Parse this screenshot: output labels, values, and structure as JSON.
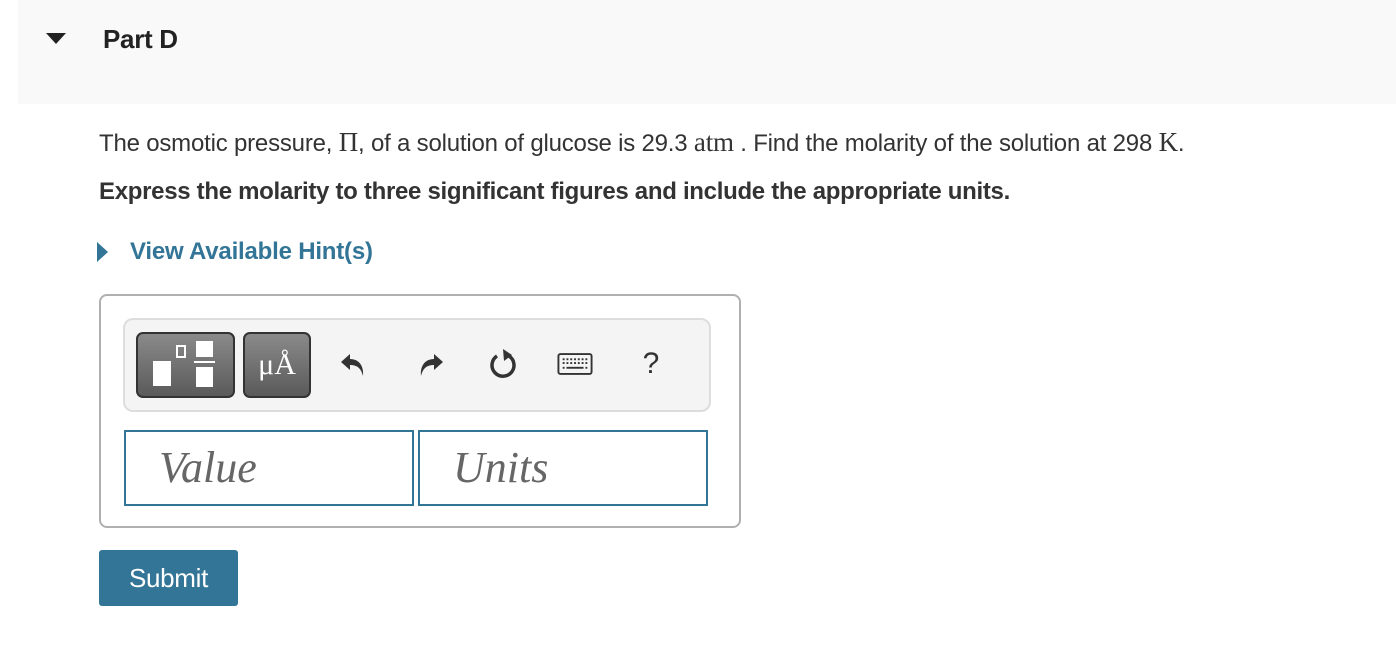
{
  "part": {
    "title": "Part D",
    "expanded": true
  },
  "question": {
    "text_before_pi": "The osmotic pressure, ",
    "pi_symbol": "Π",
    "text_after_pi": ", of a solution of glucose is 29.3 ",
    "pressure_unit": "atm",
    "text_after_unit": " . Find the molarity of the solution at 298 ",
    "temp_unit": "K",
    "end": "."
  },
  "instruction": "Express the molarity to three significant figures and include the appropriate units.",
  "hint": {
    "label": "View Available Hint(s)"
  },
  "toolbar": {
    "units_label": "μÅ",
    "help_label": "?",
    "buttons": [
      "templates",
      "units",
      "undo",
      "redo",
      "reset",
      "keyboard",
      "help"
    ]
  },
  "inputs": {
    "value_placeholder": "Value",
    "units_placeholder": "Units"
  },
  "submit_label": "Submit",
  "colors": {
    "accent": "#337596",
    "header_bg": "#f9f9f9",
    "text": "#333333"
  }
}
